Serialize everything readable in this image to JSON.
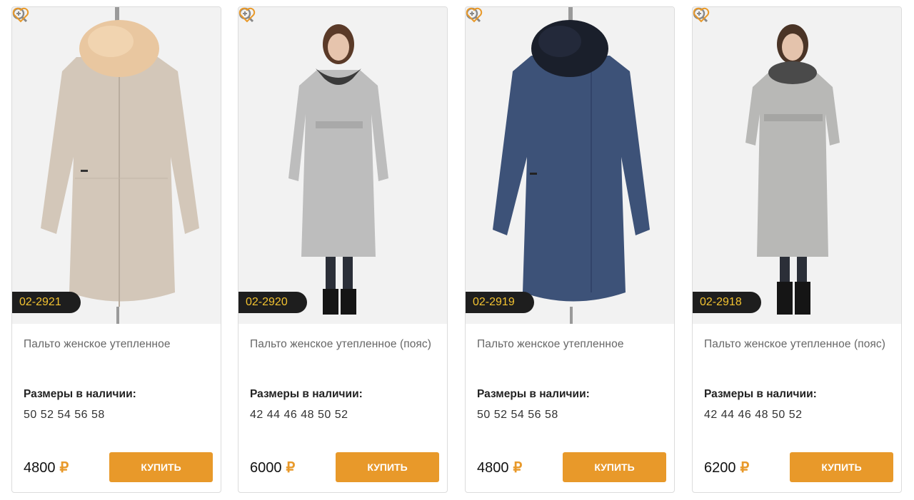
{
  "products": [
    {
      "sku": "02-2921",
      "title": "Пальто женское утепленное",
      "sizes_label": "Размеры в наличии:",
      "sizes": "50 52 54 56 58",
      "price": "4800",
      "currency": "₽",
      "buy_label": "КУПИТЬ",
      "image": "beige-coat-fur-collar",
      "coat_color": "#d3c7b9",
      "collar_color": "#e9c7a0"
    },
    {
      "sku": "02-2920",
      "title": "Пальто женское утепленное (пояс)",
      "sizes_label": "Размеры в наличии:",
      "sizes": "42 44 46 48 50 52",
      "price": "6000",
      "currency": "₽",
      "buy_label": "КУПИТЬ",
      "image": "grey-belted-coat-model",
      "coat_color": "#bdbdbd",
      "collar_color": "#3a3a3a"
    },
    {
      "sku": "02-2919",
      "title": "Пальто женское утепленное",
      "sizes_label": "Размеры в наличии:",
      "sizes": "50 52 54 56 58",
      "price": "4800",
      "currency": "₽",
      "buy_label": "КУПИТЬ",
      "image": "navy-coat-fur-collar",
      "coat_color": "#3d5278",
      "collar_color": "#1a1f2b"
    },
    {
      "sku": "02-2918",
      "title": "Пальто женское утепленное (пояс)",
      "sizes_label": "Размеры в наличии:",
      "sizes": "42 44 46 48 50 52",
      "price": "6200",
      "currency": "₽",
      "buy_label": "КУПИТЬ",
      "image": "grey-belted-coat-model-fur",
      "coat_color": "#b8b8b6",
      "collar_color": "#4a4a4a"
    }
  ],
  "colors": {
    "accent": "#e8992a",
    "sku_badge_bg": "#1e1e1e",
    "sku_badge_text": "#f2c230"
  }
}
